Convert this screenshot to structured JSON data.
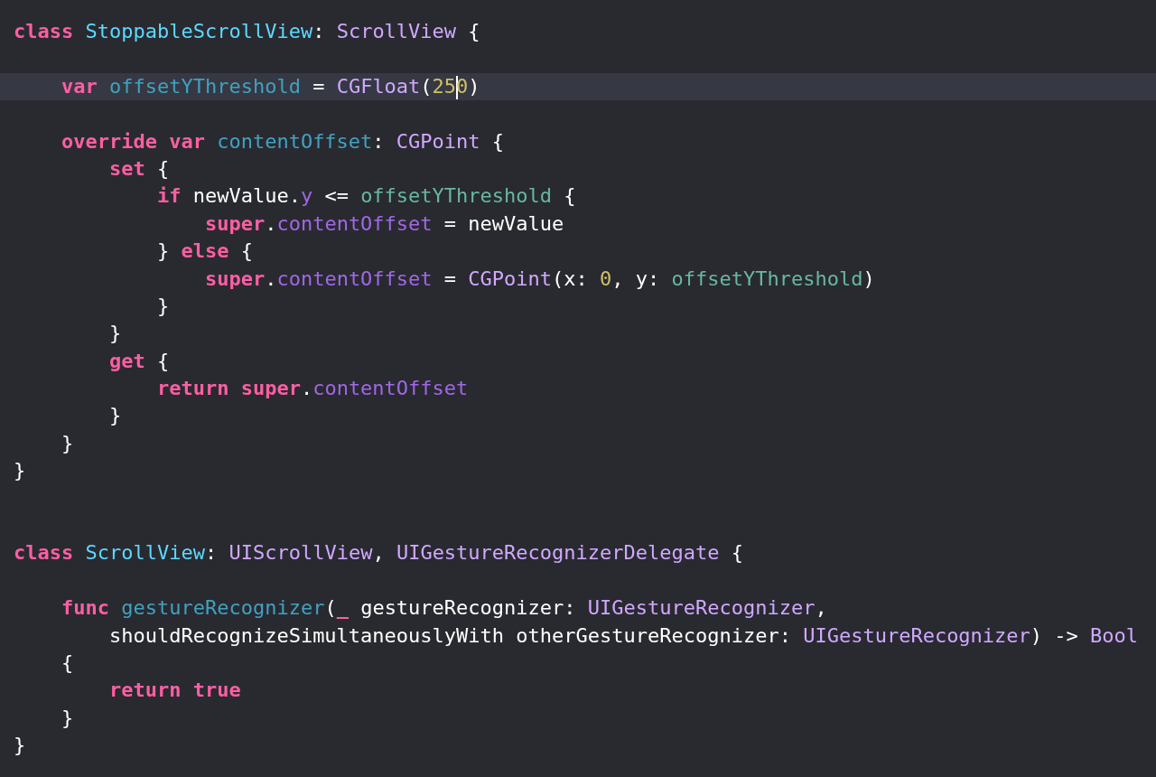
{
  "editor": {
    "lines": [
      {
        "current": false,
        "tokens": [
          {
            "kind": "keyword",
            "text": "class"
          },
          {
            "kind": "typedecl",
            "text": " StoppableScrollView"
          },
          {
            "kind": "plain",
            "text": ": "
          },
          {
            "kind": "type",
            "text": "ScrollView"
          },
          {
            "kind": "plain",
            "text": " {"
          }
        ]
      },
      {
        "current": false
      },
      {
        "current": true,
        "tokens": [
          {
            "kind": "keyword",
            "text": "    var"
          },
          {
            "kind": "decl",
            "text": " offsetYThreshold"
          },
          {
            "kind": "plain",
            "text": " = "
          },
          {
            "kind": "type",
            "text": "CGFloat"
          },
          {
            "kind": "plain",
            "text": "("
          },
          {
            "kind": "number",
            "text": "25",
            "caret_after": true
          },
          {
            "kind": "number",
            "text": "0"
          },
          {
            "kind": "plain",
            "text": ")"
          }
        ]
      },
      {
        "current": false
      },
      {
        "current": false,
        "tokens": [
          {
            "kind": "keyword",
            "text": "    override var"
          },
          {
            "kind": "decl",
            "text": " contentOffset"
          },
          {
            "kind": "plain",
            "text": ": "
          },
          {
            "kind": "type",
            "text": "CGPoint"
          },
          {
            "kind": "plain",
            "text": " {"
          }
        ]
      },
      {
        "current": false,
        "tokens": [
          {
            "kind": "keyword",
            "text": "        set"
          },
          {
            "kind": "plain",
            "text": " {"
          }
        ]
      },
      {
        "current": false,
        "tokens": [
          {
            "kind": "keyword",
            "text": "            if"
          },
          {
            "kind": "plain",
            "text": " newValue."
          },
          {
            "kind": "member",
            "text": "y"
          },
          {
            "kind": "plain",
            "text": " <= "
          },
          {
            "kind": "project",
            "text": "offsetYThreshold"
          },
          {
            "kind": "plain",
            "text": " {"
          }
        ]
      },
      {
        "current": false,
        "tokens": [
          {
            "kind": "keyword",
            "text": "                super"
          },
          {
            "kind": "plain",
            "text": "."
          },
          {
            "kind": "member",
            "text": "contentOffset"
          },
          {
            "kind": "plain",
            "text": " = newValue"
          }
        ]
      },
      {
        "current": false,
        "tokens": [
          {
            "kind": "plain",
            "text": "            } "
          },
          {
            "kind": "keyword",
            "text": "else"
          },
          {
            "kind": "plain",
            "text": " {"
          }
        ]
      },
      {
        "current": false,
        "tokens": [
          {
            "kind": "keyword",
            "text": "                super"
          },
          {
            "kind": "plain",
            "text": "."
          },
          {
            "kind": "member",
            "text": "contentOffset"
          },
          {
            "kind": "plain",
            "text": " = "
          },
          {
            "kind": "type",
            "text": "CGPoint"
          },
          {
            "kind": "plain",
            "text": "(x: "
          },
          {
            "kind": "number",
            "text": "0"
          },
          {
            "kind": "plain",
            "text": ", y: "
          },
          {
            "kind": "project",
            "text": "offsetYThreshold"
          },
          {
            "kind": "plain",
            "text": ")"
          }
        ]
      },
      {
        "current": false,
        "tokens": [
          {
            "kind": "plain",
            "text": "            }"
          }
        ]
      },
      {
        "current": false,
        "tokens": [
          {
            "kind": "plain",
            "text": "        }"
          }
        ]
      },
      {
        "current": false,
        "tokens": [
          {
            "kind": "keyword",
            "text": "        get"
          },
          {
            "kind": "plain",
            "text": " {"
          }
        ]
      },
      {
        "current": false,
        "tokens": [
          {
            "kind": "keyword",
            "text": "            return super"
          },
          {
            "kind": "plain",
            "text": "."
          },
          {
            "kind": "member",
            "text": "contentOffset"
          }
        ]
      },
      {
        "current": false,
        "tokens": [
          {
            "kind": "plain",
            "text": "        }"
          }
        ]
      },
      {
        "current": false,
        "tokens": [
          {
            "kind": "plain",
            "text": "    }"
          }
        ]
      },
      {
        "current": false,
        "tokens": [
          {
            "kind": "plain",
            "text": "}"
          }
        ]
      },
      {
        "current": false
      },
      {
        "current": false
      },
      {
        "current": false,
        "tokens": [
          {
            "kind": "keyword",
            "text": "class"
          },
          {
            "kind": "typedecl",
            "text": " ScrollView"
          },
          {
            "kind": "plain",
            "text": ": "
          },
          {
            "kind": "type",
            "text": "UIScrollView"
          },
          {
            "kind": "plain",
            "text": ", "
          },
          {
            "kind": "type",
            "text": "UIGestureRecognizerDelegate"
          },
          {
            "kind": "plain",
            "text": " {"
          }
        ]
      },
      {
        "current": false
      },
      {
        "current": false,
        "tokens": [
          {
            "kind": "keyword",
            "text": "    func"
          },
          {
            "kind": "decl",
            "text": " gestureRecognizer"
          },
          {
            "kind": "plain",
            "text": "("
          },
          {
            "kind": "keyword",
            "text": "_"
          },
          {
            "kind": "plain",
            "text": " gestureRecognizer: "
          },
          {
            "kind": "type",
            "text": "UIGestureRecognizer"
          },
          {
            "kind": "plain",
            "text": ","
          }
        ]
      },
      {
        "current": false,
        "tokens": [
          {
            "kind": "plain",
            "text": "        shouldRecognizeSimultaneouslyWith otherGestureRecognizer: "
          },
          {
            "kind": "type",
            "text": "UIGestureRecognizer"
          },
          {
            "kind": "plain",
            "text": ") -> "
          },
          {
            "kind": "type",
            "text": "Bool"
          }
        ]
      },
      {
        "current": false,
        "tokens": [
          {
            "kind": "plain",
            "text": "    {"
          }
        ]
      },
      {
        "current": false,
        "tokens": [
          {
            "kind": "keyword",
            "text": "        return true"
          }
        ]
      },
      {
        "current": false,
        "tokens": [
          {
            "kind": "plain",
            "text": "    }"
          }
        ]
      },
      {
        "current": false,
        "tokens": [
          {
            "kind": "plain",
            "text": "}"
          }
        ]
      }
    ]
  }
}
